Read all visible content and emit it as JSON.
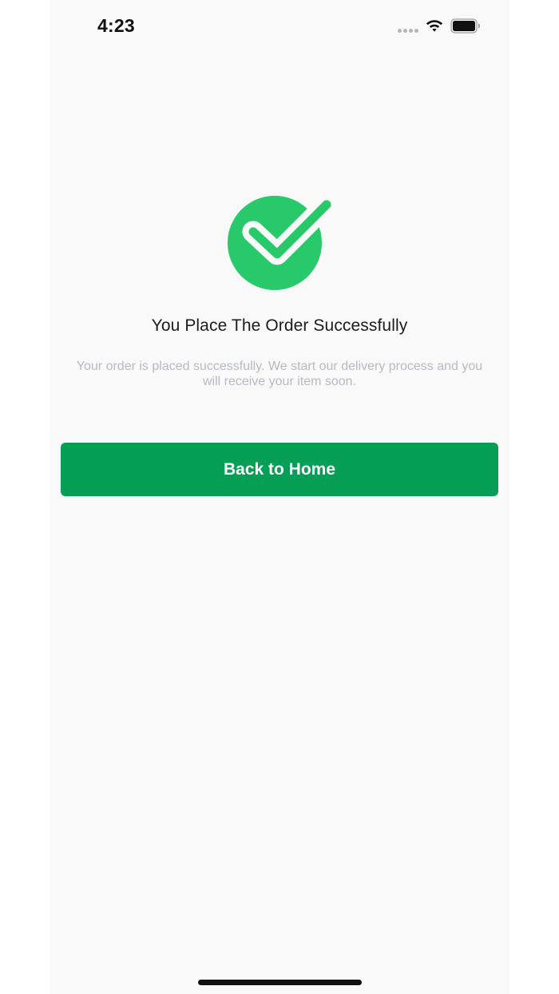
{
  "status_bar": {
    "time": "4:23"
  },
  "icons": {
    "success": "check-circle-icon",
    "wifi": "wifi-icon",
    "battery": "battery-icon",
    "signal": "signal-dots-icon"
  },
  "confirmation": {
    "title": "You Place The Order Successfully",
    "description": "Your order is placed successfully. We start our delivery process and you will receive your item soon."
  },
  "actions": {
    "back_home_label": "Back to Home"
  },
  "colors": {
    "background": "#f9f9f9",
    "success_green": "#28c96a",
    "button_green": "#049f55",
    "title_text": "#1c1c1c",
    "description_text": "#b7bac2"
  }
}
